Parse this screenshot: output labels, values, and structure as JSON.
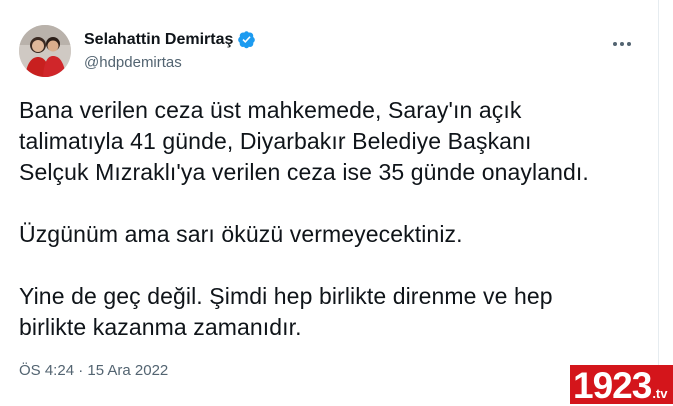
{
  "author": {
    "name": "Selahattin Demirtaş",
    "handle": "@hdpdemirtas",
    "verified": true
  },
  "tweet": {
    "paragraphs": [
      "Bana verilen ceza üst mahkemede, Saray'ın açık\ntalimatıyla 41 günde, Diyarbakır Belediye Başkanı\nSelçuk Mızraklı'ya verilen ceza ise 35 günde onaylandı.",
      "Üzgünüm ama sarı öküzü vermeyecektiniz.",
      "Yine de geç değil. Şimdi hep birlikte direnme ve hep\nbirlikte kazanma zamanıdır."
    ],
    "timestamp": "ÖS 4:24 · 15 Ara 2022"
  },
  "watermark": {
    "number": "1923",
    "tld": ".tv"
  },
  "icons": {
    "verified": "verified-badge-icon",
    "more": "more-options-icon"
  },
  "colors": {
    "text": "#0f1419",
    "secondary": "#536471",
    "verified_blue": "#1d9bf0",
    "brand_red": "#d4151b"
  }
}
